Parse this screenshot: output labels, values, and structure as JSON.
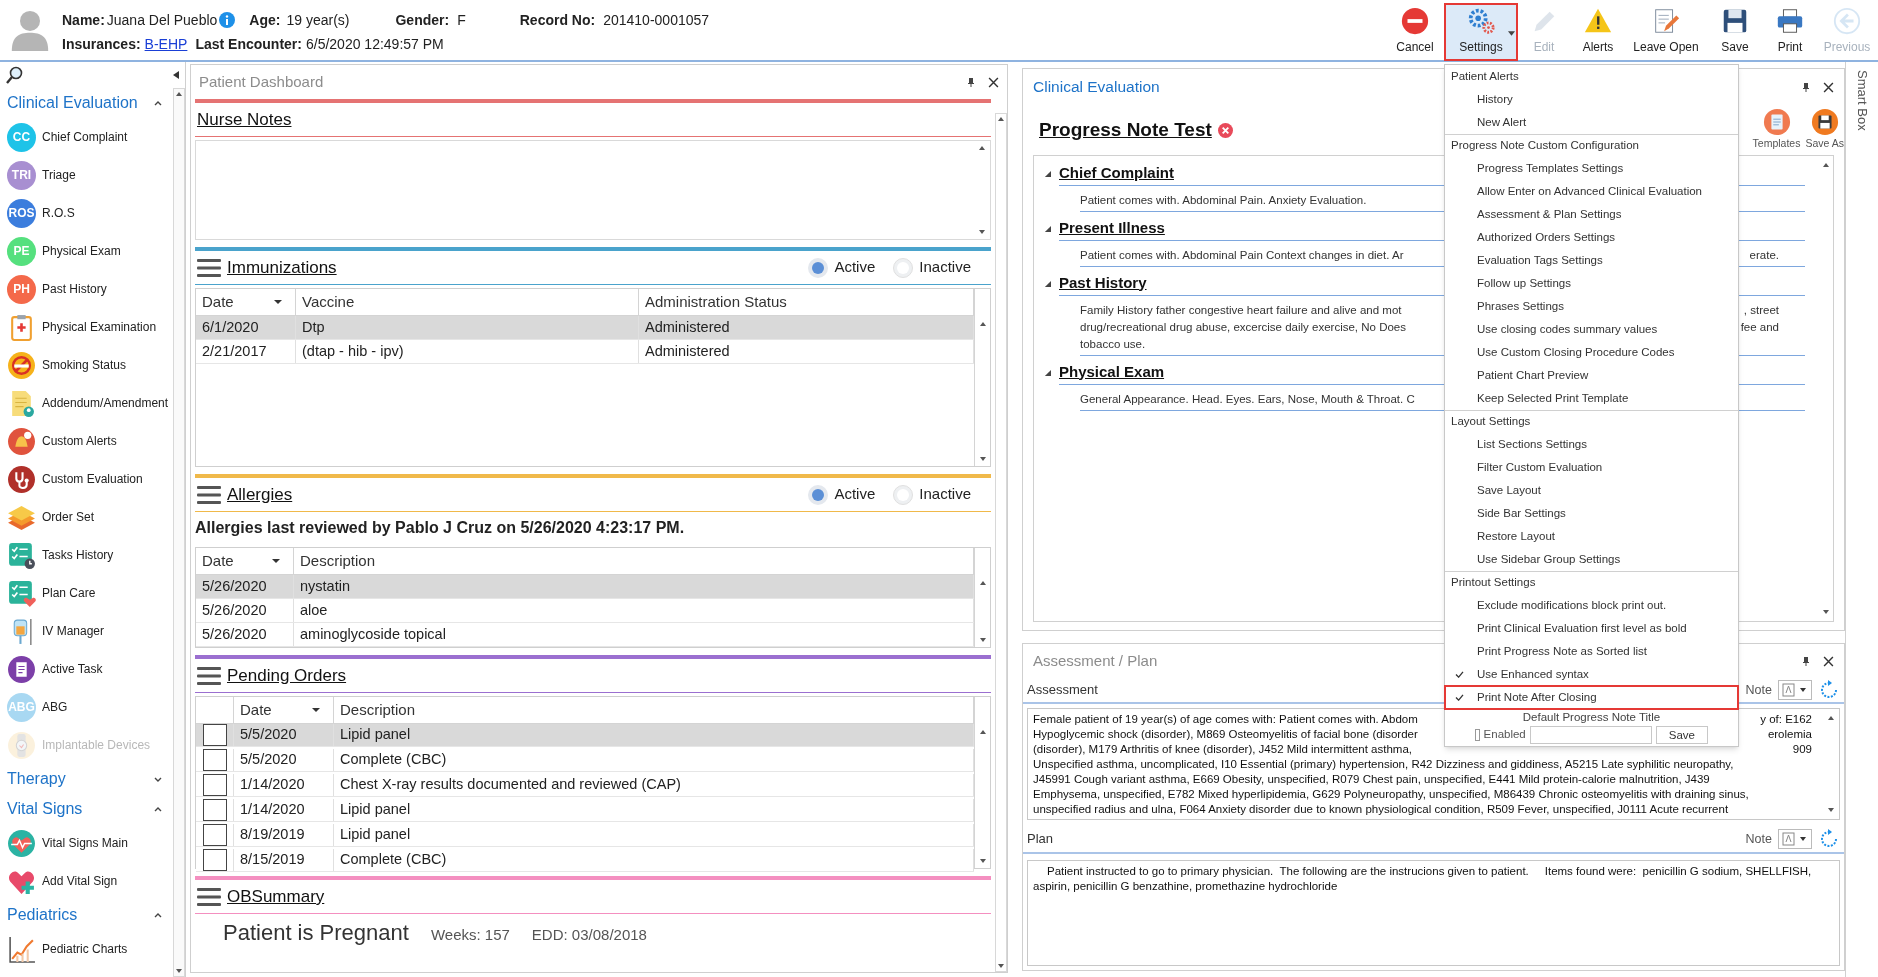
{
  "header": {
    "name_label": "Name:",
    "name": "Juana Del Pueblo",
    "age_label": "Age:",
    "age": "19 year(s)",
    "gender_label": "Gender:",
    "gender": "F",
    "record_label": "Record No:",
    "record": "201410-0001057",
    "insurances_label": "Insurances:",
    "insurance": "B-EHP",
    "last_encounter_label": "Last Encounter:",
    "last_encounter": "6/5/2020 12:49:57 PM"
  },
  "toolbar": [
    {
      "label": "Cancel",
      "kind": "cancel",
      "disabled": false,
      "selected": false
    },
    {
      "label": "Settings",
      "kind": "settings",
      "disabled": false,
      "selected": true
    },
    {
      "label": "Edit",
      "kind": "edit",
      "disabled": true,
      "selected": false
    },
    {
      "label": "Alerts",
      "kind": "alerts",
      "disabled": false,
      "selected": false
    },
    {
      "label": "Leave Open",
      "kind": "leave-open",
      "disabled": false,
      "selected": false
    },
    {
      "label": "Save",
      "kind": "save",
      "disabled": false,
      "selected": false
    },
    {
      "label": "Print",
      "kind": "print",
      "disabled": false,
      "selected": false
    },
    {
      "label": "Previous",
      "kind": "previous",
      "disabled": true,
      "selected": false
    }
  ],
  "sidebar": {
    "groups": [
      {
        "title": "Clinical Evaluation",
        "expanded": true,
        "items": [
          {
            "label": "Chief Complaint",
            "kind": "badge",
            "badge": "CC",
            "color": "#1ec3e8",
            "disabled": false
          },
          {
            "label": "Triage",
            "kind": "badge",
            "badge": "TRI",
            "color": "#a88fd1",
            "disabled": false
          },
          {
            "label": "R.O.S",
            "kind": "badge",
            "badge": "ROS",
            "color": "#3b7ddd",
            "disabled": false
          },
          {
            "label": "Physical Exam",
            "kind": "badge",
            "badge": "PE",
            "color": "#55e07e",
            "disabled": false
          },
          {
            "label": "Past History",
            "kind": "badge",
            "badge": "PH",
            "color": "#f4694a",
            "disabled": false
          },
          {
            "label": "Physical Examination",
            "kind": "clipboard",
            "disabled": false
          },
          {
            "label": "Smoking Status",
            "kind": "no-smoking",
            "disabled": false
          },
          {
            "label": "Addendum/Amendment",
            "kind": "document",
            "disabled": false
          },
          {
            "label": "Custom Alerts",
            "kind": "bell",
            "disabled": false
          },
          {
            "label": "Custom Evaluation",
            "kind": "stethoscope",
            "disabled": false
          },
          {
            "label": "Order Set",
            "kind": "layers",
            "disabled": false
          },
          {
            "label": "Tasks History",
            "kind": "checklist-clock",
            "disabled": false
          },
          {
            "label": "Plan Care",
            "kind": "checklist-heart",
            "disabled": false
          },
          {
            "label": "IV Manager",
            "kind": "iv-bag",
            "disabled": false
          },
          {
            "label": "Active Task",
            "kind": "clipboard-circle",
            "disabled": false
          },
          {
            "label": "ABG",
            "kind": "badge",
            "badge": "ABG",
            "color": "#a8d8f2",
            "disabled": false
          },
          {
            "label": "Implantable Devices",
            "kind": "watch",
            "disabled": true
          }
        ]
      },
      {
        "title": "Therapy",
        "expanded": false
      },
      {
        "title": "Vital Signs",
        "expanded": true,
        "items": [
          {
            "label": "Vital Signs Main",
            "kind": "heart-pulse",
            "disabled": false
          },
          {
            "label": "Add Vital Sign",
            "kind": "heart-plus",
            "disabled": false
          }
        ]
      },
      {
        "title": "Pediatrics",
        "expanded": true,
        "items": [
          {
            "label": "Pediatric Charts",
            "kind": "chart",
            "disabled": false
          }
        ]
      }
    ]
  },
  "dashboard": {
    "title": "Patient Dashboard",
    "sections": [
      {
        "kind": "notes",
        "title": "Nurse Notes",
        "color": "#e57373"
      },
      {
        "kind": "grid",
        "title": "Immunizations",
        "color": "#4aa3cc",
        "filters": [
          {
            "label": "Active",
            "selected": true
          },
          {
            "label": "Inactive",
            "selected": false
          }
        ],
        "columns": [
          "Date",
          "Vaccine",
          "Administration Status"
        ],
        "rows": [
          {
            "cells": [
              "6/1/2020",
              "Dtp",
              "Administered"
            ],
            "selected": true
          },
          {
            "cells": [
              "2/21/2017",
              "(dtap - hib - ipv)",
              "Administered"
            ],
            "selected": false
          }
        ]
      },
      {
        "kind": "grid",
        "title": "Allergies",
        "color": "#f0b94a",
        "filters": [
          {
            "label": "Active",
            "selected": true
          },
          {
            "label": "Inactive",
            "selected": false
          }
        ],
        "note": "Allergies last reviewed by Pablo J Cruz on 5/26/2020 4:23:17 PM.",
        "columns": [
          "Date",
          "Description"
        ],
        "rows": [
          {
            "cells": [
              "5/26/2020",
              "nystatin"
            ],
            "selected": true
          },
          {
            "cells": [
              "5/26/2020",
              "aloe"
            ],
            "selected": false
          },
          {
            "cells": [
              "5/26/2020",
              "aminoglycoside topical"
            ],
            "selected": false
          }
        ]
      },
      {
        "kind": "grid",
        "title": "Pending Orders",
        "color": "#9b6fd0",
        "columns": [
          "Date",
          "Description"
        ],
        "rows": [
          {
            "cells": [
              "5/5/2020",
              "Lipid panel"
            ],
            "selected": true,
            "checked": false
          },
          {
            "cells": [
              "5/5/2020",
              "Complete (CBC)"
            ],
            "selected": false,
            "checked": false
          },
          {
            "cells": [
              "1/14/2020",
              "Chest X-ray results documented and reviewed (CAP)"
            ],
            "selected": false,
            "checked": false
          },
          {
            "cells": [
              "1/14/2020",
              "Lipid panel"
            ],
            "selected": false,
            "checked": false
          },
          {
            "cells": [
              "8/19/2019",
              "Lipid panel"
            ],
            "selected": false,
            "checked": false
          },
          {
            "cells": [
              "8/15/2019",
              "Complete (CBC)"
            ],
            "selected": false,
            "checked": false
          }
        ]
      },
      {
        "kind": "summary",
        "title": "OBSummary",
        "color": "#f48fc0",
        "headline": "Patient is Pregnant",
        "weeks": "Weeks: 157",
        "edd": "EDD: 03/08/2018"
      }
    ]
  },
  "clinical_evaluation": {
    "title": "Clinical Evaluation",
    "note_title": "Progress Note Test",
    "actions": [
      {
        "label": "Templates",
        "kind": "templates"
      },
      {
        "label": "Save As",
        "kind": "save-as"
      }
    ],
    "sections": [
      {
        "title": "Chief Complaint",
        "expanded": true,
        "lines": [
          {
            "parts": [
              "Patient comes with. Abdominal Pain. Anxiety Evaluation."
            ]
          }
        ]
      },
      {
        "title": "Present Illness",
        "expanded": true,
        "lines": [
          {
            "parts": [
              "Patient comes with. Abdominal Pain Context changes in diet. Ar",
              "erate."
            ]
          }
        ]
      },
      {
        "title": "Past History",
        "expanded": true,
        "lines": [
          {
            "parts": [
              "Family History father congestive heart failure and alive and mot",
              ", street"
            ]
          },
          {
            "parts": [
              "drug/recreational drug abuse, excercise daily exercise, No Does",
              "fee and"
            ]
          },
          {
            "parts": [
              "tobacco use."
            ]
          }
        ]
      },
      {
        "title": "Physical Exam",
        "expanded": true,
        "lines": [
          {
            "parts": [
              "General Appearance. Head. Eyes. Ears, Nose, Mouth & Throat. C"
            ]
          }
        ]
      }
    ]
  },
  "assessment_plan": {
    "title": "Assessment / Plan",
    "assessment": {
      "label": "Assessment",
      "note_label": "Note",
      "lines": [
        {
          "parts": [
            "Female patient of 19 year(s) of age comes with: Patient comes with. Abdom",
            "y of: E162"
          ]
        },
        {
          "parts": [
            "Hypoglycemic shock (disorder), M869 Osteomyelitis of facial bone (disorder",
            "erolemia"
          ]
        },
        {
          "parts": [
            "(disorder), M179 Arthritis of knee (disorder), J452 Mild intermittent asthma,",
            "909"
          ]
        },
        {
          "parts": [
            "Unspecified asthma, uncomplicated, I10 Essential (primary) hypertension, R42 Dizziness and giddiness, A5215 Late syphilitic neuropathy,"
          ]
        },
        {
          "parts": [
            "J45991 Cough variant asthma, E669 Obesity, unspecified, R079 Chest pain, unspecified, E441 Mild protein-calorie malnutrition, J439"
          ]
        },
        {
          "parts": [
            "Emphysema, unspecified, E782 Mixed hyperlipidemia, G629 Polyneuropathy, unspecified, M86439 Chronic osteomyelitis with draining sinus,"
          ]
        },
        {
          "parts": [
            "unspecified radius and ulna, F064 Anxiety disorder due to known physiological condition, R509 Fever, unspecified, J0111 Acute recurrent"
          ]
        }
      ]
    },
    "plan": {
      "label": "Plan",
      "note_label": "Note",
      "text": "Patient instructed to go to primary physician.  The following are the instrucions given to patient.     Items found were:  penicillin G sodium, SHELLFISH, aspirin, penicillin G benzathine, promethazine hydrochloride"
    }
  },
  "smart_box": {
    "label": "Smart Box"
  },
  "settings_menu": {
    "groups": [
      {
        "title": "Patient Alerts",
        "items": [
          {
            "label": "History",
            "checked": false,
            "selected": false
          },
          {
            "label": "New Alert",
            "checked": false,
            "selected": false
          }
        ]
      },
      {
        "title": "Progress Note Custom Configuration",
        "items": [
          {
            "label": "Progress Templates Settings",
            "checked": false,
            "selected": false
          },
          {
            "label": "Allow Enter on Advanced Clinical Evaluation",
            "checked": false,
            "selected": false
          },
          {
            "label": "Assessment & Plan Settings",
            "checked": false,
            "selected": false
          },
          {
            "label": "Authorized Orders Settings",
            "checked": false,
            "selected": false
          },
          {
            "label": "Evaluation Tags Settings",
            "checked": false,
            "selected": false
          },
          {
            "label": "Follow up Settings",
            "checked": false,
            "selected": false
          },
          {
            "label": "Phrases Settings",
            "checked": false,
            "selected": false
          },
          {
            "label": "Use closing codes summary values",
            "checked": false,
            "selected": false
          },
          {
            "label": "Use Custom Closing Procedure Codes",
            "checked": false,
            "selected": false
          },
          {
            "label": "Patient Chart Preview",
            "checked": false,
            "selected": false
          },
          {
            "label": "Keep Selected Print Template",
            "checked": false,
            "selected": false
          }
        ]
      },
      {
        "title": "Layout Settings",
        "items": [
          {
            "label": "List Sections Settings",
            "checked": false,
            "selected": false
          },
          {
            "label": "Filter Custom Evaluation",
            "checked": false,
            "selected": false
          },
          {
            "label": "Save Layout",
            "checked": false,
            "selected": false
          },
          {
            "label": "Side Bar Settings",
            "checked": false,
            "selected": false
          },
          {
            "label": "Restore Layout",
            "checked": false,
            "selected": false
          },
          {
            "label": "Use Sidebar Group Settings",
            "checked": false,
            "selected": false
          }
        ]
      },
      {
        "title": "Printout Settings",
        "items": [
          {
            "label": "Exclude modifications block print out.",
            "checked": false,
            "selected": false
          },
          {
            "label": "Print Clinical Evaluation first level as bold",
            "checked": false,
            "selected": false
          },
          {
            "label": "Print Progress Note as Sorted list",
            "checked": false,
            "selected": false
          },
          {
            "label": "Use Enhanced syntax",
            "checked": true,
            "selected": false
          },
          {
            "label": "Print Note After Closing",
            "checked": true,
            "selected": true
          }
        ]
      }
    ],
    "default_title": {
      "label": "Default Progress Note Title",
      "enabled_label": "Enabled",
      "enabled": false,
      "button": "Save"
    }
  }
}
